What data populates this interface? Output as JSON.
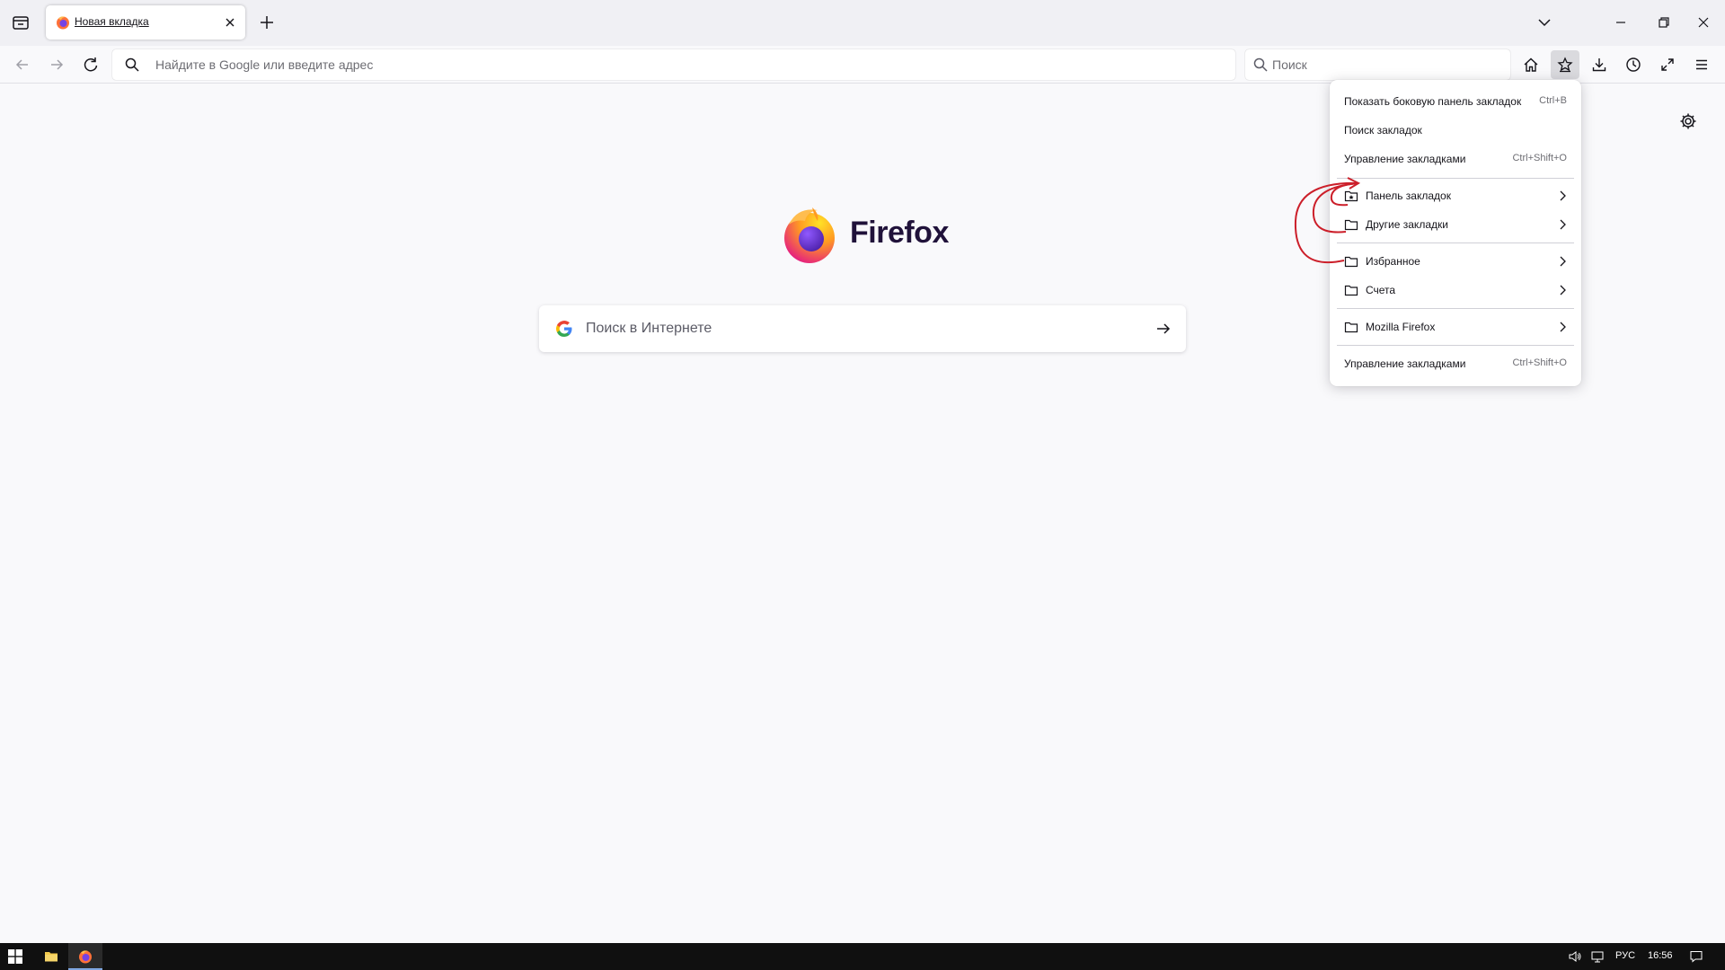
{
  "browser": {
    "tab": {
      "title": "Новая вкладка"
    },
    "urlbar": {
      "placeholder": "Найдите в Google или введите адрес"
    },
    "searchbar": {
      "placeholder": "Поиск"
    }
  },
  "newtab": {
    "brand": "Firefox",
    "search_placeholder": "Поиск в Интернете"
  },
  "bookmarks_menu": {
    "show_sidebar": {
      "label": "Показать боковую панель закладок",
      "shortcut": "Ctrl+B"
    },
    "search": {
      "label": "Поиск закладок"
    },
    "manage_top": {
      "label": "Управление закладками",
      "shortcut": "Ctrl+Shift+O"
    },
    "folders": [
      {
        "label": "Панель закладок"
      },
      {
        "label": "Другие закладки"
      },
      {
        "label": "Избранное"
      },
      {
        "label": "Счета"
      },
      {
        "label": "Mozilla Firefox"
      }
    ],
    "manage_bottom": {
      "label": "Управление закладками",
      "shortcut": "Ctrl+Shift+O"
    }
  },
  "taskbar": {
    "language": "РУС",
    "time": "16:56"
  },
  "colors": {
    "annotation": "#cc1f2a",
    "toolbar_active": "#dadade",
    "taskbar": "#101010"
  }
}
